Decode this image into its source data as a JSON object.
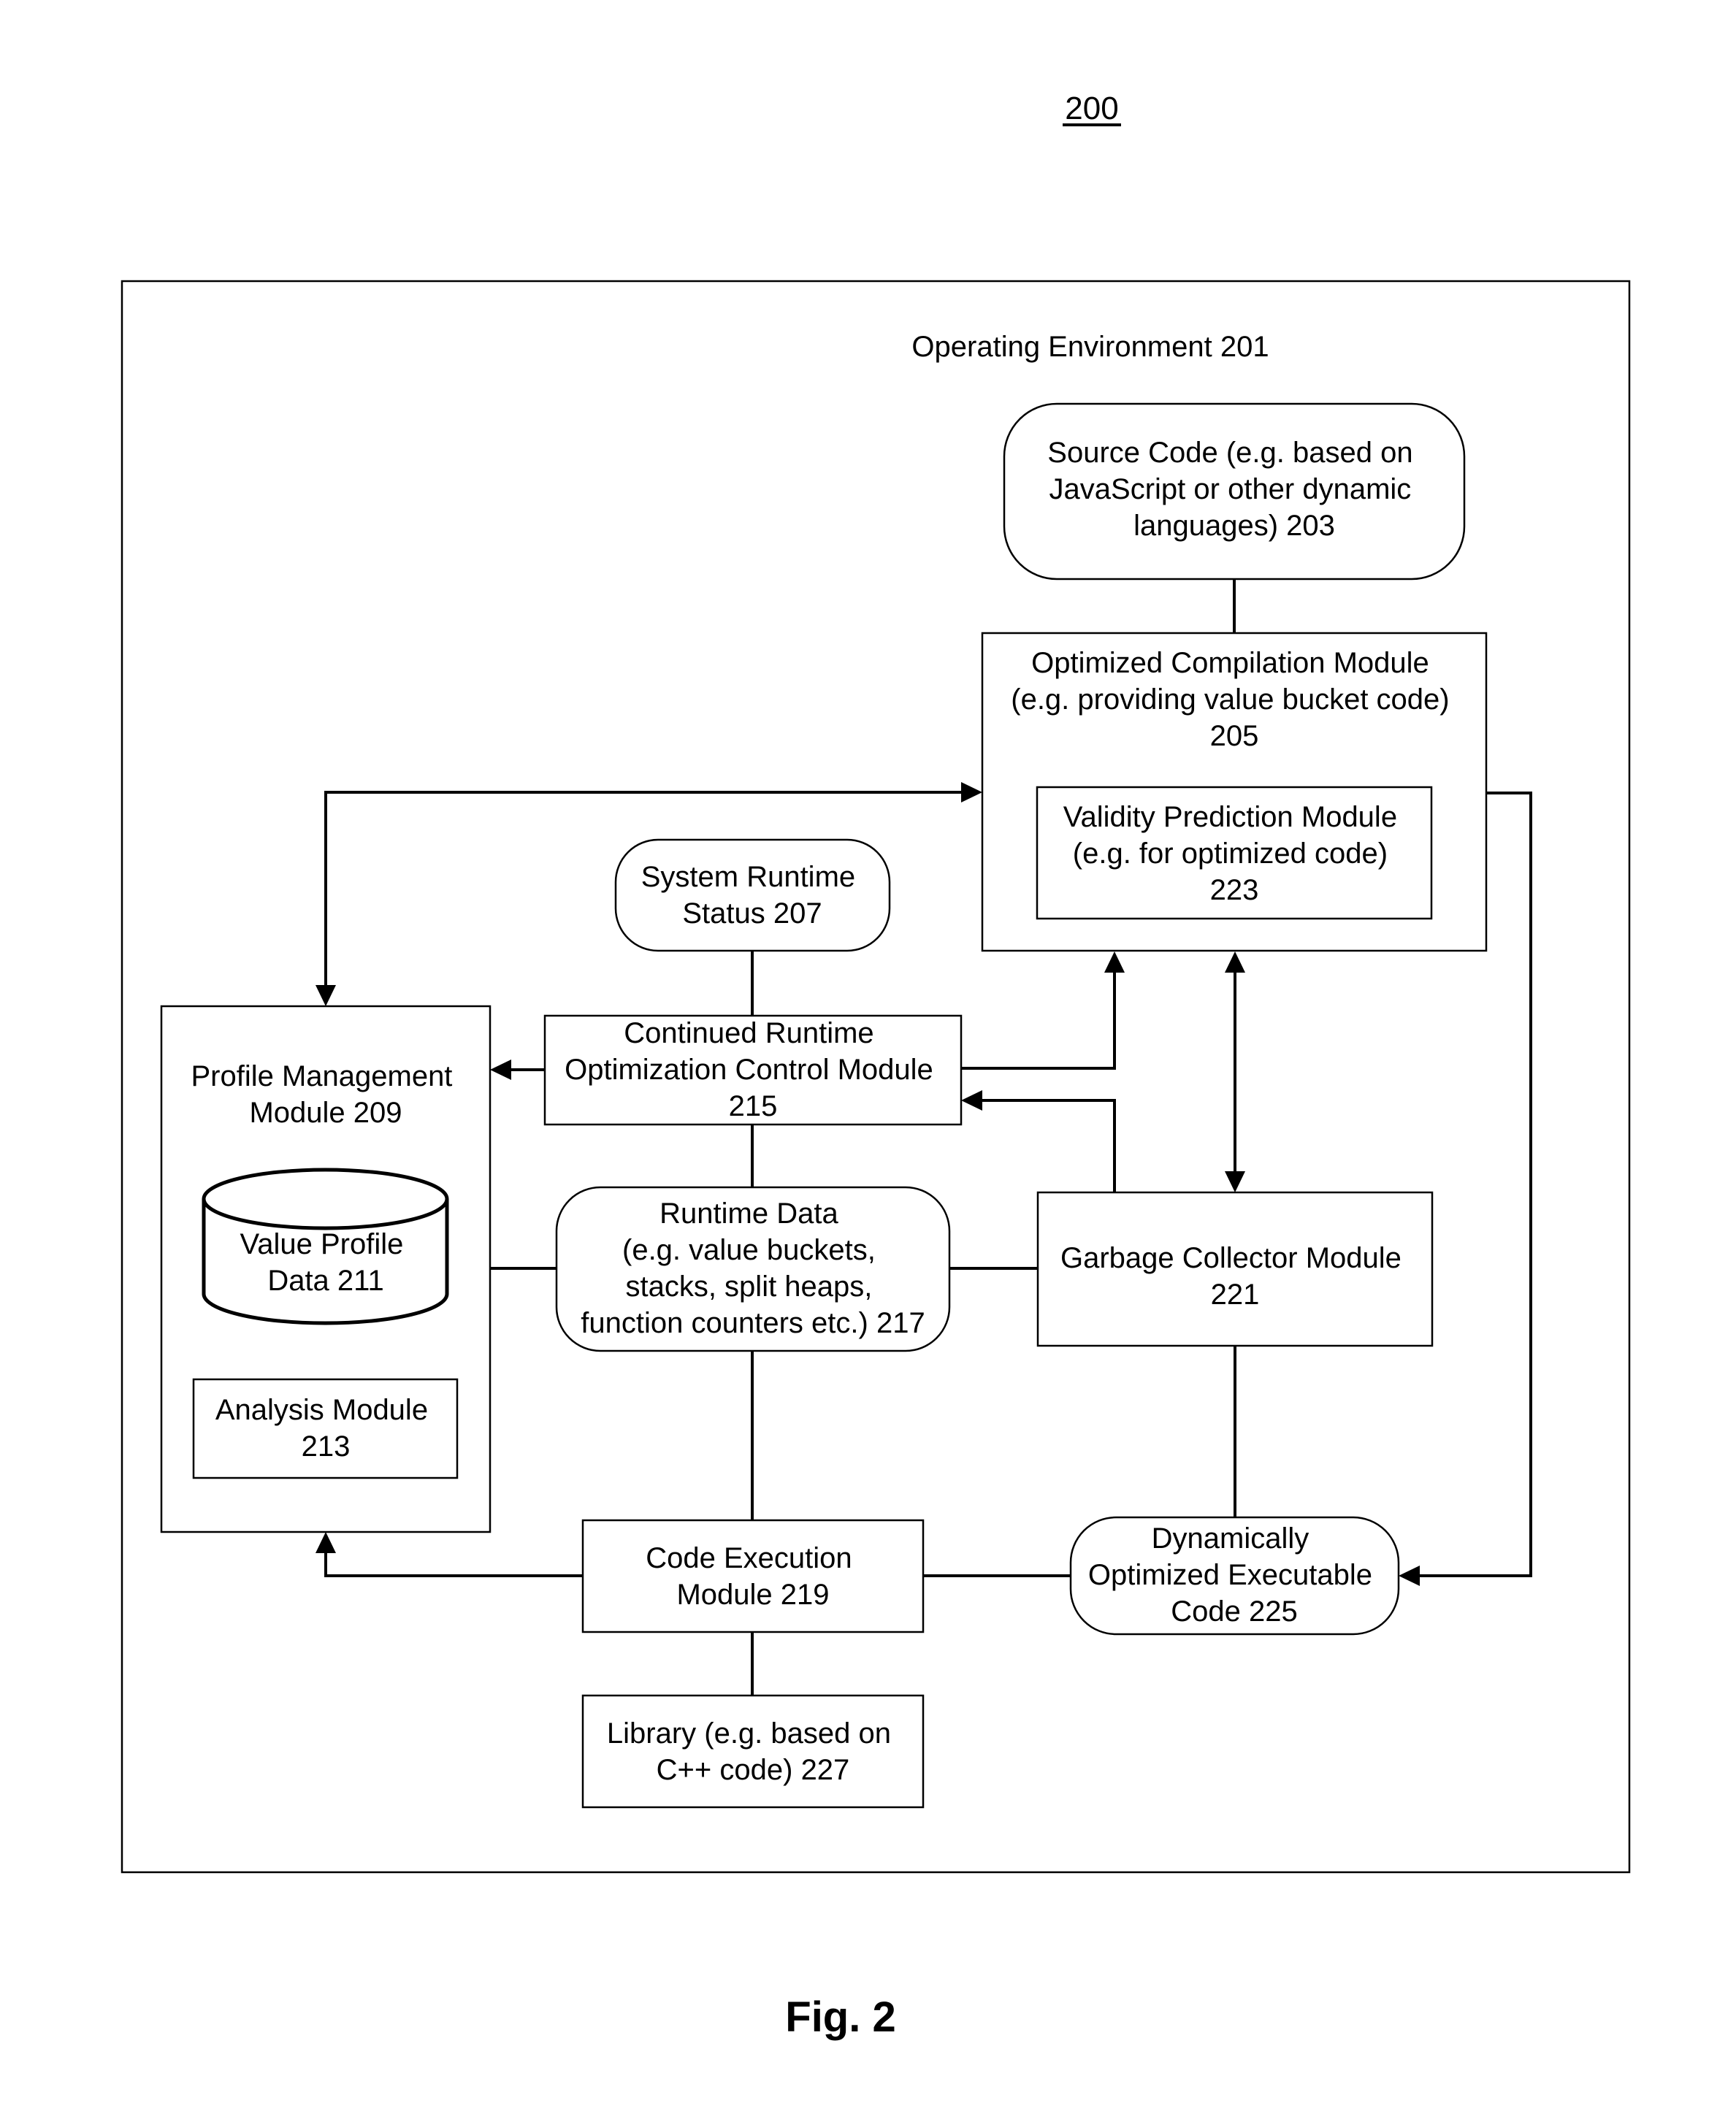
{
  "figure": {
    "number_label": "200",
    "caption": "Fig. 2",
    "environment_label": "Operating Environment 201"
  },
  "nodes": {
    "source_code": {
      "lines": [
        "Source Code (e.g. based on",
        "JavaScript or other dynamic",
        "languages)  203"
      ]
    },
    "optimized_compilation": {
      "lines": [
        "Optimized Compilation Module",
        "(e.g. providing value bucket code)",
        "205"
      ]
    },
    "validity_prediction": {
      "lines": [
        "Validity Prediction Module",
        "(e.g. for optimized code)",
        "223"
      ]
    },
    "system_runtime_status": {
      "lines": [
        "System Runtime",
        "Status 207"
      ]
    },
    "profile_management": {
      "lines": [
        "Profile Management",
        "Module 209"
      ]
    },
    "value_profile_data": {
      "lines": [
        "Value Profile",
        "Data 211"
      ]
    },
    "analysis_module": {
      "lines": [
        "Analysis Module",
        "213"
      ]
    },
    "continued_runtime": {
      "lines": [
        "Continued Runtime",
        "Optimization Control Module",
        "215"
      ]
    },
    "runtime_data": {
      "lines": [
        "Runtime Data",
        "(e.g. value buckets,",
        "stacks, split heaps,",
        "function counters etc.) 217"
      ]
    },
    "garbage_collector": {
      "lines": [
        "Garbage Collector Module",
        "221"
      ]
    },
    "code_execution": {
      "lines": [
        "Code Execution",
        "Module  219"
      ]
    },
    "dynamically_optimized_code": {
      "lines": [
        "Dynamically",
        "Optimized Executable",
        "Code 225"
      ]
    },
    "library": {
      "lines": [
        "Library (e.g. based on",
        "C++ code) 227"
      ]
    }
  },
  "edges": [
    {
      "from": "source_code",
      "to": "optimized_compilation",
      "arrow": "none"
    },
    {
      "from": "optimized_compilation",
      "to": "profile_management",
      "arrow": "both"
    },
    {
      "from": "optimized_compilation",
      "to": "dynamically_optimized_code",
      "arrow": "end"
    },
    {
      "from": "system_runtime_status",
      "to": "continued_runtime",
      "arrow": "none"
    },
    {
      "from": "continued_runtime",
      "to": "profile_management",
      "arrow": "end"
    },
    {
      "from": "continued_runtime",
      "to": "optimized_compilation",
      "arrow": "end"
    },
    {
      "from": "garbage_collector",
      "to": "continued_runtime",
      "arrow": "end"
    },
    {
      "from": "optimized_compilation",
      "to": "garbage_collector",
      "arrow": "both"
    },
    {
      "from": "continued_runtime",
      "to": "runtime_data",
      "arrow": "none"
    },
    {
      "from": "profile_management",
      "to": "runtime_data",
      "arrow": "none"
    },
    {
      "from": "runtime_data",
      "to": "garbage_collector",
      "arrow": "none"
    },
    {
      "from": "runtime_data",
      "to": "code_execution",
      "arrow": "none"
    },
    {
      "from": "garbage_collector",
      "to": "dynamically_optimized_code",
      "arrow": "none"
    },
    {
      "from": "code_execution",
      "to": "dynamically_optimized_code",
      "arrow": "none"
    },
    {
      "from": "code_execution",
      "to": "profile_management",
      "arrow": "end"
    },
    {
      "from": "code_execution",
      "to": "library",
      "arrow": "none"
    }
  ]
}
